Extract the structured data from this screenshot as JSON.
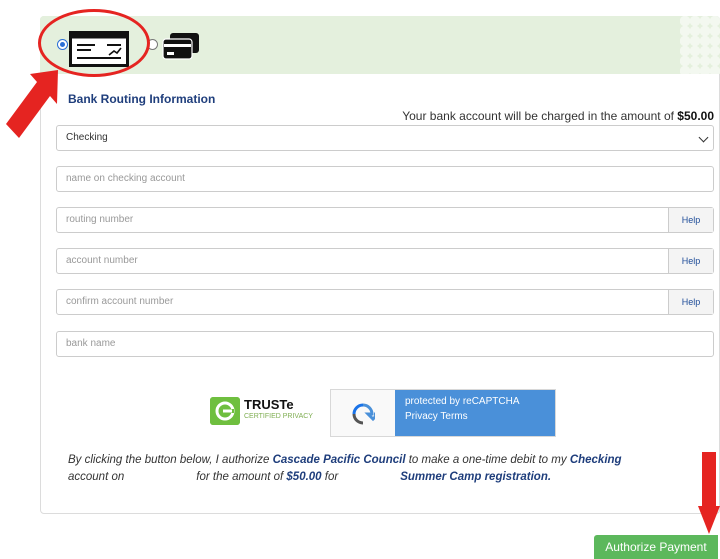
{
  "payment_methods": {
    "check": {
      "selected": true,
      "icon": "bank-check-icon"
    },
    "card": {
      "selected": false,
      "icon": "credit-card-icon"
    }
  },
  "section": {
    "title": "Bank Routing Information"
  },
  "charge": {
    "prefix": "Your bank account will be charged in the amount of ",
    "amount": "$50.00"
  },
  "form": {
    "account_type": {
      "selected": "Checking"
    },
    "name_placeholder": "name on checking account",
    "routing_placeholder": "routing number",
    "account_placeholder": "account number",
    "confirm_placeholder": "confirm account number",
    "bank_placeholder": "bank name",
    "help_label": "Help"
  },
  "badges": {
    "truste_title": "TRUSTe",
    "truste_sub": "CERTIFIED PRIVACY",
    "recaptcha_line": "protected by reCAPTCHA",
    "recaptcha_privacy": "Privacy",
    "recaptcha_terms": "Terms"
  },
  "legal": {
    "p1": "By clicking the button below, I authorize ",
    "org": "Cascade Pacific Council",
    "p2": " to make a one-time debit to my ",
    "acct": "Checking",
    "p3": "account on",
    "p4": "for the amount of ",
    "amount": "$50.00",
    "p5": " for",
    "purpose": "Summer Camp registration."
  },
  "authorize_label": "Authorize Payment",
  "colors": {
    "accent_red": "#e52421",
    "button_green": "#5cb85c",
    "bar_green": "#e4f0dd",
    "title_blue": "#1f3e7c"
  }
}
